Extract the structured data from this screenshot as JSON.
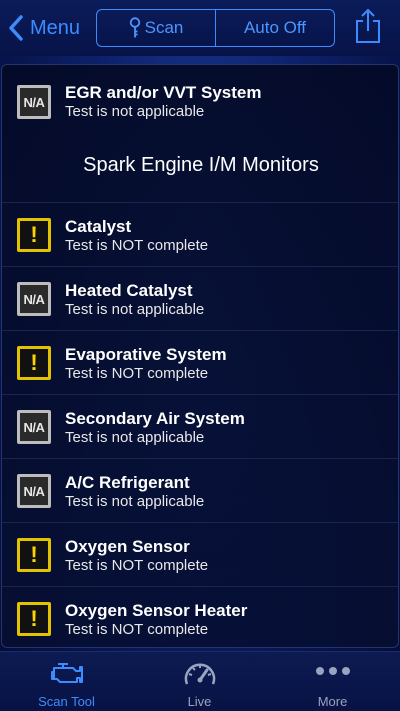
{
  "header": {
    "back_label": "Menu",
    "segments": [
      "Scan",
      "Auto Off"
    ]
  },
  "list": {
    "section_title": "Spark Engine I/M Monitors",
    "items": [
      {
        "status": "na",
        "badge": "N/A",
        "title": "EGR and/or VVT System",
        "subtitle": "Test is not applicable"
      },
      {
        "status": "warn",
        "badge": "!",
        "title": "Catalyst",
        "subtitle": "Test is NOT complete"
      },
      {
        "status": "na",
        "badge": "N/A",
        "title": "Heated Catalyst",
        "subtitle": "Test is not applicable"
      },
      {
        "status": "warn",
        "badge": "!",
        "title": "Evaporative System",
        "subtitle": "Test is NOT complete"
      },
      {
        "status": "na",
        "badge": "N/A",
        "title": "Secondary Air System",
        "subtitle": "Test is not applicable"
      },
      {
        "status": "na",
        "badge": "N/A",
        "title": "A/C Refrigerant",
        "subtitle": "Test is not applicable"
      },
      {
        "status": "warn",
        "badge": "!",
        "title": "Oxygen Sensor",
        "subtitle": "Test is NOT complete"
      },
      {
        "status": "warn",
        "badge": "!",
        "title": "Oxygen Sensor Heater",
        "subtitle": "Test is NOT complete"
      }
    ]
  },
  "tabs": [
    {
      "label": "Scan Tool",
      "icon": "engine-icon",
      "active": true
    },
    {
      "label": "Live",
      "icon": "gauge-icon",
      "active": false
    },
    {
      "label": "More",
      "icon": "more-icon",
      "active": false
    }
  ],
  "colors": {
    "accent": "#3c8cff",
    "warning": "#e3c300",
    "na": "#bdbdbd",
    "inactive_tab": "#9aa3bf"
  }
}
